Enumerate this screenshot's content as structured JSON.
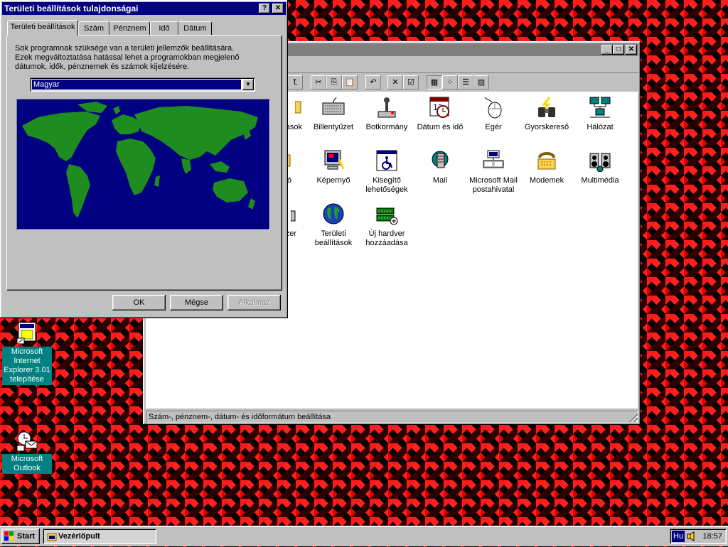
{
  "desktop": {
    "icons": [
      {
        "label": "Microsoft Internet Explorer 3.01 telepítése"
      },
      {
        "label": "Microsoft Outlook"
      }
    ]
  },
  "control_panel": {
    "items_row1": [
      "asok",
      "Billentyűzet",
      "Botkormány",
      "Dátum és idő",
      "Egér",
      "Gyorskereső",
      "Hálózat"
    ],
    "items_row2": [
      "ó",
      "Képernyő",
      "Kisegítő lehetőségek",
      "Mail",
      "Microsoft Mail postahivatal",
      "Modemek",
      "Multimédia"
    ],
    "items_row3": [
      "zer",
      "Területi beállítások",
      "Új hardver hozzáadása"
    ],
    "status": "Szám-, pénznem-, dátum- és időformátum beállítása"
  },
  "dialog": {
    "title": "Területi beállítások tulajdonságai",
    "help_glyph": "?",
    "close_glyph": "✕",
    "tabs": [
      "Területi beállítások",
      "Szám",
      "Pénznem",
      "Idő",
      "Dátum"
    ],
    "description": "Sok programnak szüksége van a területi jellemzők beállítására. Ezek megváltoztatása hatással lehet a programokban megjelenő dátumok, idők, pénznemek és számok kijelzésére.",
    "locale_value": "Magyar",
    "buttons": {
      "ok": "OK",
      "cancel": "Mégse",
      "apply": "Alkalmaz"
    }
  },
  "taskbar": {
    "start_label": "Start",
    "task_label": "Vezérlőpult",
    "lang": "Hu",
    "clock": "18:57"
  },
  "colors": {
    "title_active": "#000080",
    "title_inactive": "#808080",
    "desktop_label_bg": "#008080",
    "map_ocean": "#000080",
    "map_land": "#1f8c1f"
  }
}
